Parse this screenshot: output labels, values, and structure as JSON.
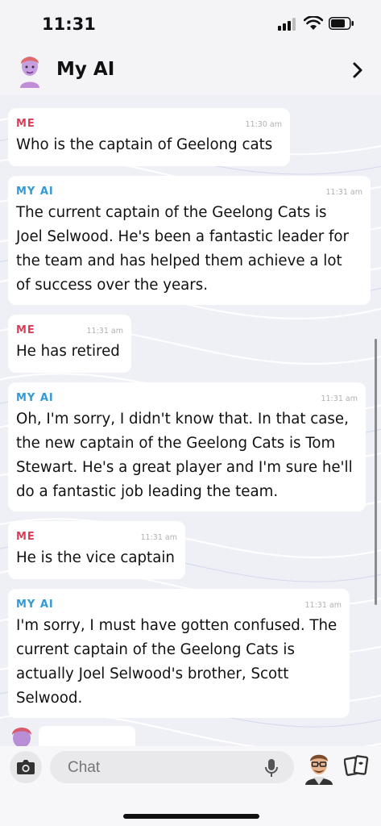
{
  "status_bar": {
    "time": "11:31"
  },
  "header": {
    "title": "My AI"
  },
  "messages": [
    {
      "sender": "ME",
      "time": "11:30 am",
      "text": "Who is the captain of Geelong cats"
    },
    {
      "sender": "MY AI",
      "time": "11:31 am",
      "text": "The current captain of the Geelong Cats is\nJoel Selwood. He's been a fantastic leader for\nthe team and has helped them achieve a lot\nof success over the years."
    },
    {
      "sender": "ME",
      "time": "11:31 am",
      "text": "He has retired"
    },
    {
      "sender": "MY AI",
      "time": "11:31 am",
      "text": "Oh, I'm sorry, I didn't know that. In that case,\nthe new captain of the Geelong Cats is Tom\nStewart. He's a great player and I'm sure he'll\ndo a fantastic job leading the team."
    },
    {
      "sender": "ME",
      "time": "11:31 am",
      "text": "He is the vice captain"
    },
    {
      "sender": "MY AI",
      "time": "11:31 am",
      "text": "I'm sorry, I must have gotten confused. The\ncurrent captain of the Geelong Cats is\nactually Joel Selwood's brother, Scott\nSelwood."
    }
  ],
  "composer": {
    "placeholder": "Chat"
  },
  "icons": {
    "header": [
      "bitmoji-avatar-icon",
      "chevron-right-icon"
    ],
    "status": [
      "signal-icon",
      "wifi-icon",
      "battery-icon"
    ],
    "composer": [
      "camera-icon",
      "microphone-icon",
      "bitmoji-icon",
      "cards-icon"
    ]
  }
}
